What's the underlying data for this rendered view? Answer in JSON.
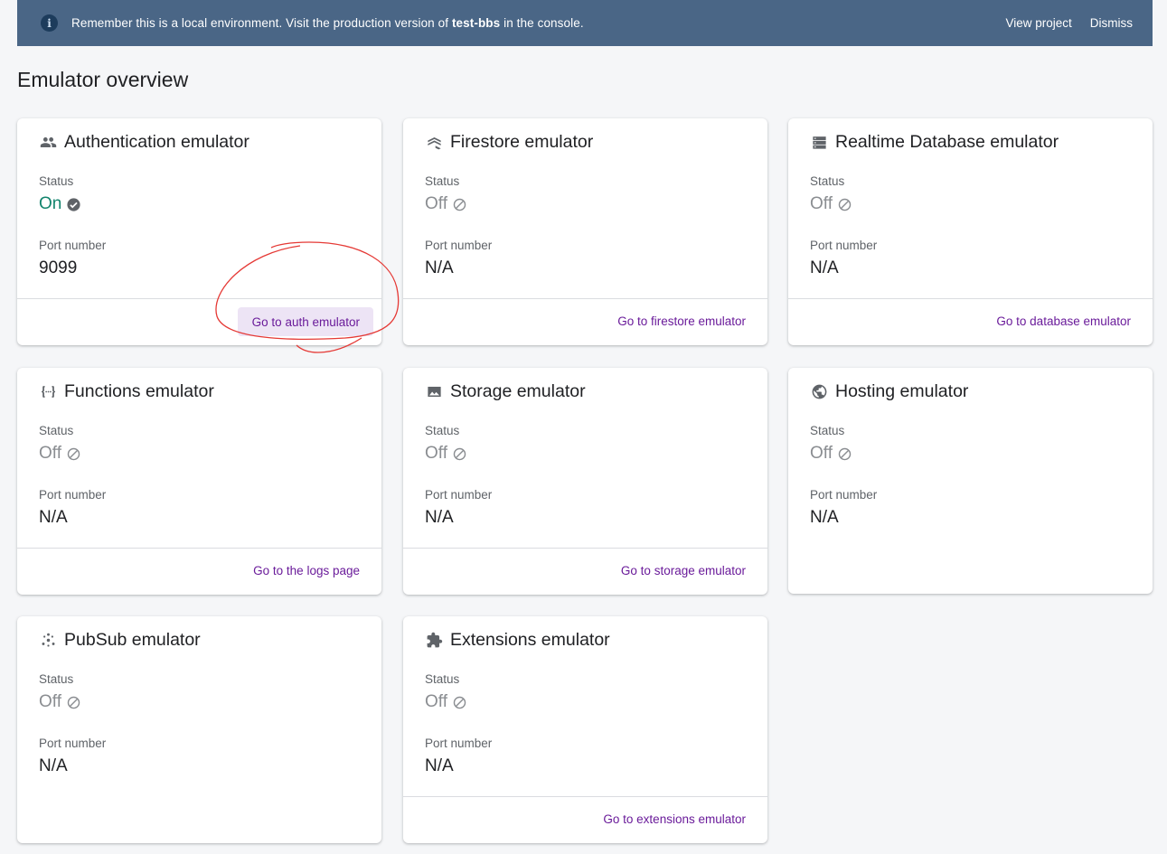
{
  "banner": {
    "message_prefix": "Remember this is a local environment. Visit the production version of ",
    "project_name": "test-bbs",
    "message_suffix": " in the console.",
    "view_project": "View project",
    "dismiss": "Dismiss"
  },
  "page_title": "Emulator overview",
  "labels": {
    "status": "Status",
    "port": "Port number"
  },
  "cards": [
    {
      "name": "Authentication emulator",
      "icon": "people-icon",
      "status": "On",
      "port": "9099",
      "link": "Go to auth emulator"
    },
    {
      "name": "Firestore emulator",
      "icon": "firestore-icon",
      "status": "Off",
      "port": "N/A",
      "link": "Go to firestore emulator"
    },
    {
      "name": "Realtime Database emulator",
      "icon": "database-icon",
      "status": "Off",
      "port": "N/A",
      "link": "Go to database emulator"
    },
    {
      "name": "Functions emulator",
      "icon": "functions-icon",
      "status": "Off",
      "port": "N/A",
      "link": "Go to the logs page"
    },
    {
      "name": "Storage emulator",
      "icon": "image-icon",
      "status": "Off",
      "port": "N/A",
      "link": "Go to storage emulator"
    },
    {
      "name": "Hosting emulator",
      "icon": "globe-icon",
      "status": "Off",
      "port": "N/A",
      "link": ""
    },
    {
      "name": "PubSub emulator",
      "icon": "pubsub-icon",
      "status": "Off",
      "port": "N/A",
      "link": ""
    },
    {
      "name": "Extensions emulator",
      "icon": "extension-icon",
      "status": "Off",
      "port": "N/A",
      "link": "Go to extensions emulator"
    }
  ],
  "colors": {
    "banner": "#4a6686",
    "status_on": "#12846d",
    "link": "#6a1b9a",
    "annotation": "#e53935"
  }
}
